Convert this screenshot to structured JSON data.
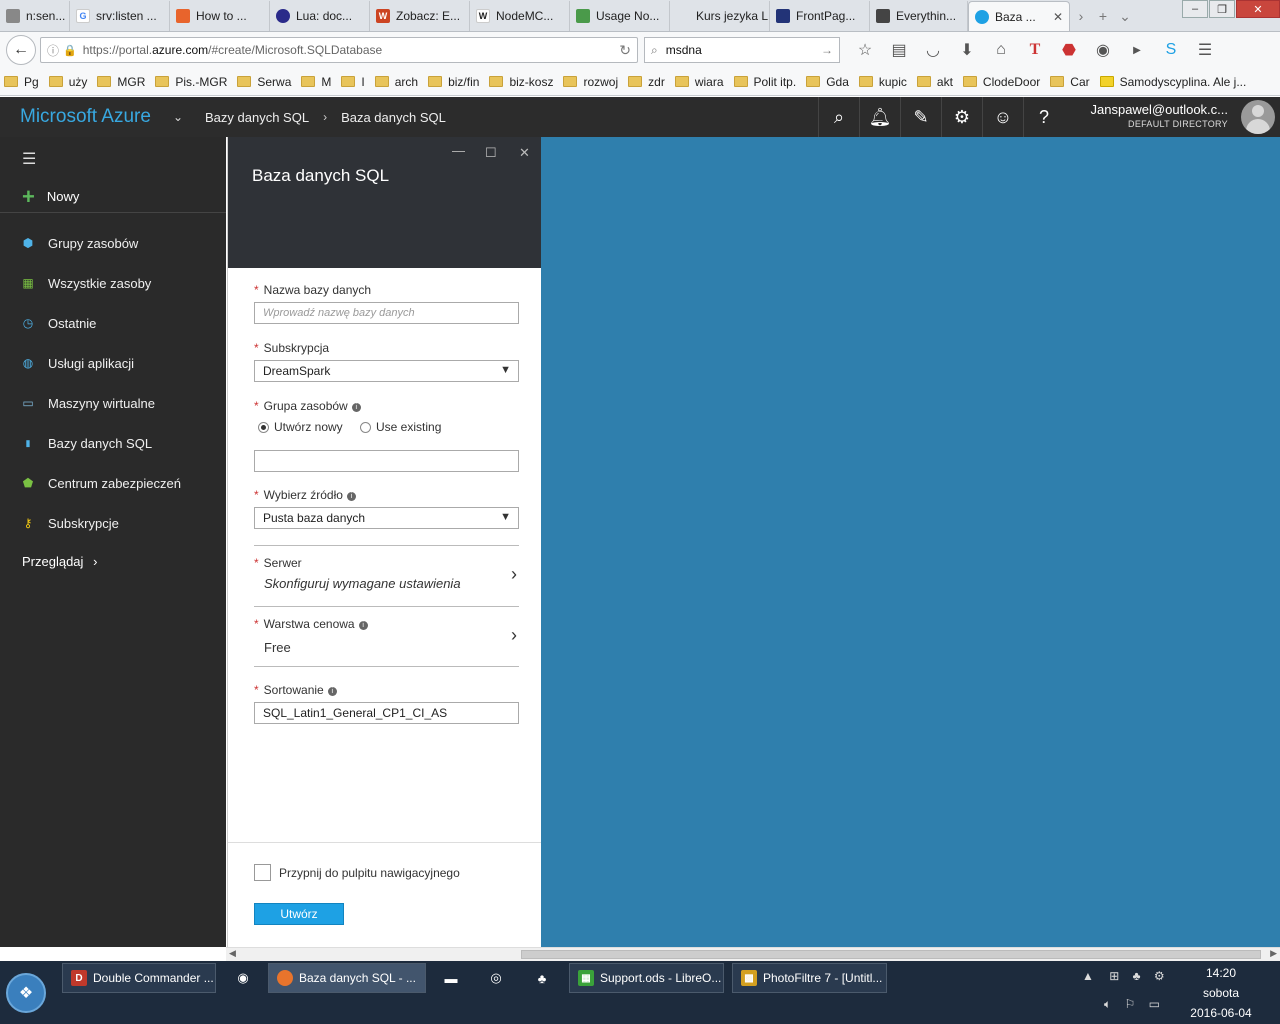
{
  "browser": {
    "tabs": [
      {
        "label": "n:sen...",
        "icon": "generic-icon",
        "color": "#888888"
      },
      {
        "label": "srv:listen ...",
        "icon": "google-icon",
        "color": "#4285f4"
      },
      {
        "label": "How to ...",
        "icon": "stack-icon",
        "color": "#e8642c"
      },
      {
        "label": "Lua: doc...",
        "icon": "lua-icon",
        "color": "#2a2a8a"
      },
      {
        "label": "Zobacz: E...",
        "icon": "w-icon",
        "color": "#cc4422"
      },
      {
        "label": "NodeMC...",
        "icon": "wikipedia-icon",
        "color": "#555555"
      },
      {
        "label": "Usage No...",
        "icon": "leaf-icon",
        "color": "#4a9a4a"
      },
      {
        "label": "Kurs jezyka L...",
        "icon": "blank-icon",
        "color": "#bbbbbb"
      },
      {
        "label": "FrontPag...",
        "icon": "page-icon",
        "color": "#223377"
      },
      {
        "label": "Everythin...",
        "icon": "glasses-icon",
        "color": "#444444"
      },
      {
        "label": "Baza ...",
        "icon": "cloud-icon",
        "color": "#1ea1e4"
      }
    ],
    "url_prefix": "https://portal.",
    "url_domain": "azure.com",
    "url_rest": "/#create/Microsoft.SQLDatabase",
    "search_value": "msdna",
    "bookmarks": [
      "Pg",
      "uży",
      "MGR",
      "Pis.-MGR",
      "Serwa",
      "M",
      "I",
      "arch",
      "biz/fin",
      "biz-kosz",
      "rozwoj",
      "zdr",
      "wiara",
      "Polit itp.",
      "Gda",
      "kupic",
      "akt",
      "ClodeDoor",
      "Car",
      "Samodyscyplina. Ale j..."
    ]
  },
  "azure": {
    "brand": "Microsoft Azure",
    "breadcrumb1": "Bazy danych SQL",
    "breadcrumb2": "Baza danych SQL",
    "user_name": "Janspawel@outlook.c...",
    "user_dir": "DEFAULT DIRECTORY"
  },
  "sidebar": {
    "new_label": "Nowy",
    "items": [
      {
        "label": "Grupy zasobów",
        "icon": "resource-group-icon"
      },
      {
        "label": "Wszystkie zasoby",
        "icon": "grid-icon"
      },
      {
        "label": "Ostatnie",
        "icon": "clock-icon"
      },
      {
        "label": "Usługi aplikacji",
        "icon": "globe-icon"
      },
      {
        "label": "Maszyny wirtualne",
        "icon": "monitor-icon"
      },
      {
        "label": "Bazy danych SQL",
        "icon": "sql-icon"
      },
      {
        "label": "Centrum zabezpieczeń",
        "icon": "shield-icon"
      },
      {
        "label": "Subskrypcje",
        "icon": "key-icon"
      }
    ],
    "browse_label": "Przeglądaj"
  },
  "blade": {
    "title": "Baza danych SQL",
    "db_name_label": "Nazwa bazy danych",
    "db_name_placeholder": "Wprowadź nazwę bazy danych",
    "subscription_label": "Subskrypcja",
    "subscription_value": "DreamSpark",
    "resource_group_label": "Grupa zasobów",
    "radio_new": "Utwórz nowy",
    "radio_existing": "Use existing",
    "source_label": "Wybierz źródło",
    "source_value": "Pusta baza danych",
    "server_label": "Serwer",
    "server_value": "Skonfiguruj wymagane ustawienia",
    "pricing_label": "Warstwa cenowa",
    "pricing_value": "Free",
    "collation_label": "Sortowanie",
    "collation_value": "SQL_Latin1_General_CP1_CI_AS",
    "pin_label": "Przypnij do pulpitu nawigacyjnego",
    "create_label": "Utwórz"
  },
  "taskbar": {
    "items": [
      {
        "label": "Double Commander ...",
        "color": "#c0392b"
      },
      {
        "label": "Baza danych SQL - ...",
        "color": "#e8742c"
      },
      {
        "label": "Support.ods - LibreO...",
        "color": "#3aa23a"
      },
      {
        "label": "PhotoFiltre 7 - [Untitl...",
        "color": "#d4a020"
      }
    ],
    "time": "14:20",
    "day": "sobota",
    "date": "2016-06-04"
  },
  "colors": {
    "accent": "#1ea1e4",
    "canvas": "#2f7fad",
    "sidebar": "#2a2a2a"
  }
}
